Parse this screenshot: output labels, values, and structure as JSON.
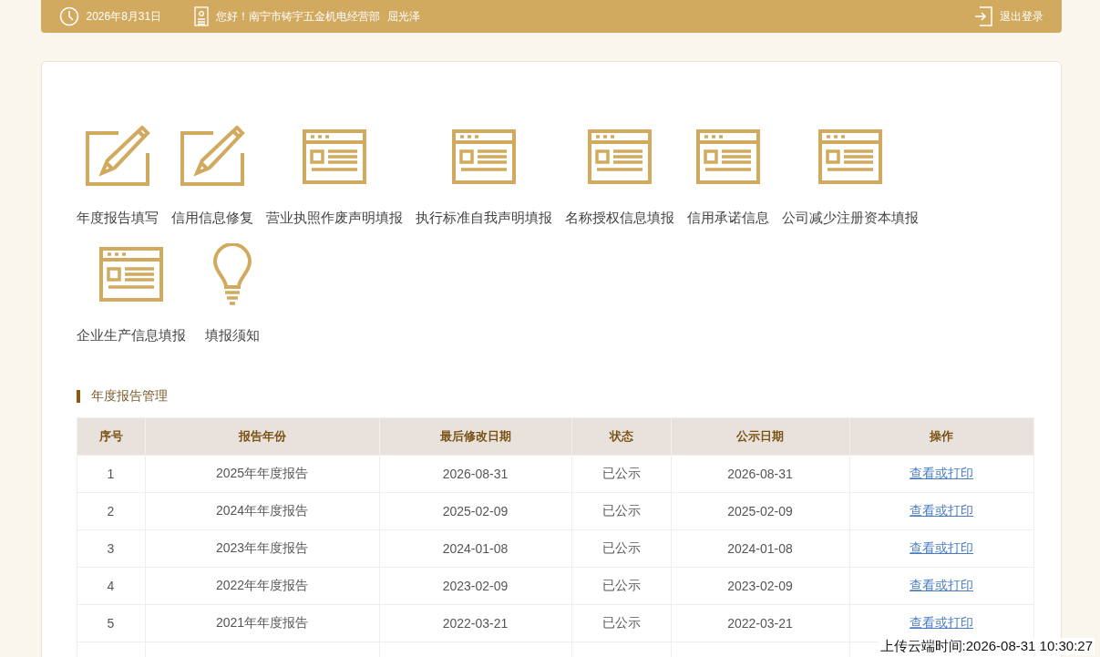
{
  "top_bar": {
    "date": "2026年8月31日",
    "greeting": "您好！南宁市铸宇五金机电经营部",
    "user": "屈光泽",
    "logout": "退出登录"
  },
  "services": [
    {
      "label": "年度报告填写",
      "kind": "pencil"
    },
    {
      "label": "信用信息修复",
      "kind": "pencil"
    },
    {
      "label": "营业执照作废声明填报",
      "kind": "form"
    },
    {
      "label": "执行标准自我声明填报",
      "kind": "form"
    },
    {
      "label": "名称授权信息填报",
      "kind": "form"
    },
    {
      "label": "信用承诺信息",
      "kind": "form"
    },
    {
      "label": "公司减少注册资本填报",
      "kind": "form"
    },
    {
      "label": "企业生产信息填报",
      "kind": "form"
    },
    {
      "label": "填报须知",
      "kind": "bulb"
    }
  ],
  "section_title": "年度报告管理",
  "table": {
    "columns": [
      "序号",
      "报告年份",
      "最后修改日期",
      "状态",
      "公示日期",
      "操作"
    ],
    "rows": [
      [
        "1",
        "2025年年度报告",
        "2026-08-31",
        "已公示",
        "2026-08-31",
        "查看或打印"
      ],
      [
        "2",
        "2024年年度报告",
        "2025-02-09",
        "已公示",
        "2025-02-09",
        "查看或打印"
      ],
      [
        "3",
        "2023年年度报告",
        "2024-01-08",
        "已公示",
        "2024-01-08",
        "查看或打印"
      ],
      [
        "4",
        "2022年年度报告",
        "2023-02-09",
        "已公示",
        "2023-02-09",
        "查看或打印"
      ],
      [
        "5",
        "2021年年度报告",
        "2022-03-21",
        "已公示",
        "2022-03-21",
        "查看或打印"
      ]
    ]
  },
  "upload_time": "上传云端时间:2026-08-31 10:30:27"
}
